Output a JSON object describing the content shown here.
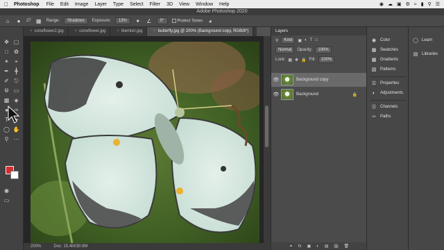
{
  "menubar": {
    "apple": "",
    "app": "Photoshop",
    "items": [
      "File",
      "Edit",
      "Image",
      "Layer",
      "Type",
      "Select",
      "Filter",
      "3D",
      "View",
      "Window",
      "Help"
    ]
  },
  "window": {
    "title": "Adobe Photoshop 2020"
  },
  "options": {
    "brush_size": "27",
    "range_label": "Range:",
    "range_value": "Shadows",
    "exposure_label": "Exposure:",
    "exposure_value": "13%",
    "angle_value": "0°",
    "protect_tones": "Protect Tones"
  },
  "tabs": [
    {
      "label": "coneflower2.jpg"
    },
    {
      "label": "coneflower.jpg"
    },
    {
      "label": "blemish.jpg"
    },
    {
      "label": "butterfly.jpg @ 200% (Background copy, RGB/8*)"
    }
  ],
  "status": {
    "zoom": "200%",
    "doc": "Doc: 15.4M/30.9M"
  },
  "layers_panel": {
    "title": "Layers",
    "kind_label": "Kind",
    "blend_mode": "Normal",
    "opacity_label": "Opacity:",
    "opacity_value": "100%",
    "lock_label": "Lock:",
    "fill_label": "Fill:",
    "fill_value": "100%",
    "layers": [
      {
        "name": "Background copy",
        "selected": true
      },
      {
        "name": "Background",
        "selected": false
      }
    ],
    "footer": "fx"
  },
  "side_panels": [
    {
      "label": "Color",
      "icon": "color-wheel-icon"
    },
    {
      "label": "Swatches",
      "icon": "grid-icon"
    },
    {
      "label": "Gradients",
      "icon": "gradient-icon"
    },
    {
      "label": "Patterns",
      "icon": "pattern-icon"
    },
    {
      "label": "Properties",
      "icon": "properties-icon"
    },
    {
      "label": "Adjustments",
      "icon": "adjust-icon"
    },
    {
      "label": "Channels",
      "icon": "channels-icon"
    },
    {
      "label": "Paths",
      "icon": "paths-icon"
    }
  ],
  "learn_panels": [
    {
      "label": "Learn",
      "icon": "bulb-icon"
    },
    {
      "label": "Libraries",
      "icon": "libraries-icon"
    }
  ],
  "colors": {
    "foreground": "#d32f2f",
    "background": "#ffffff"
  }
}
